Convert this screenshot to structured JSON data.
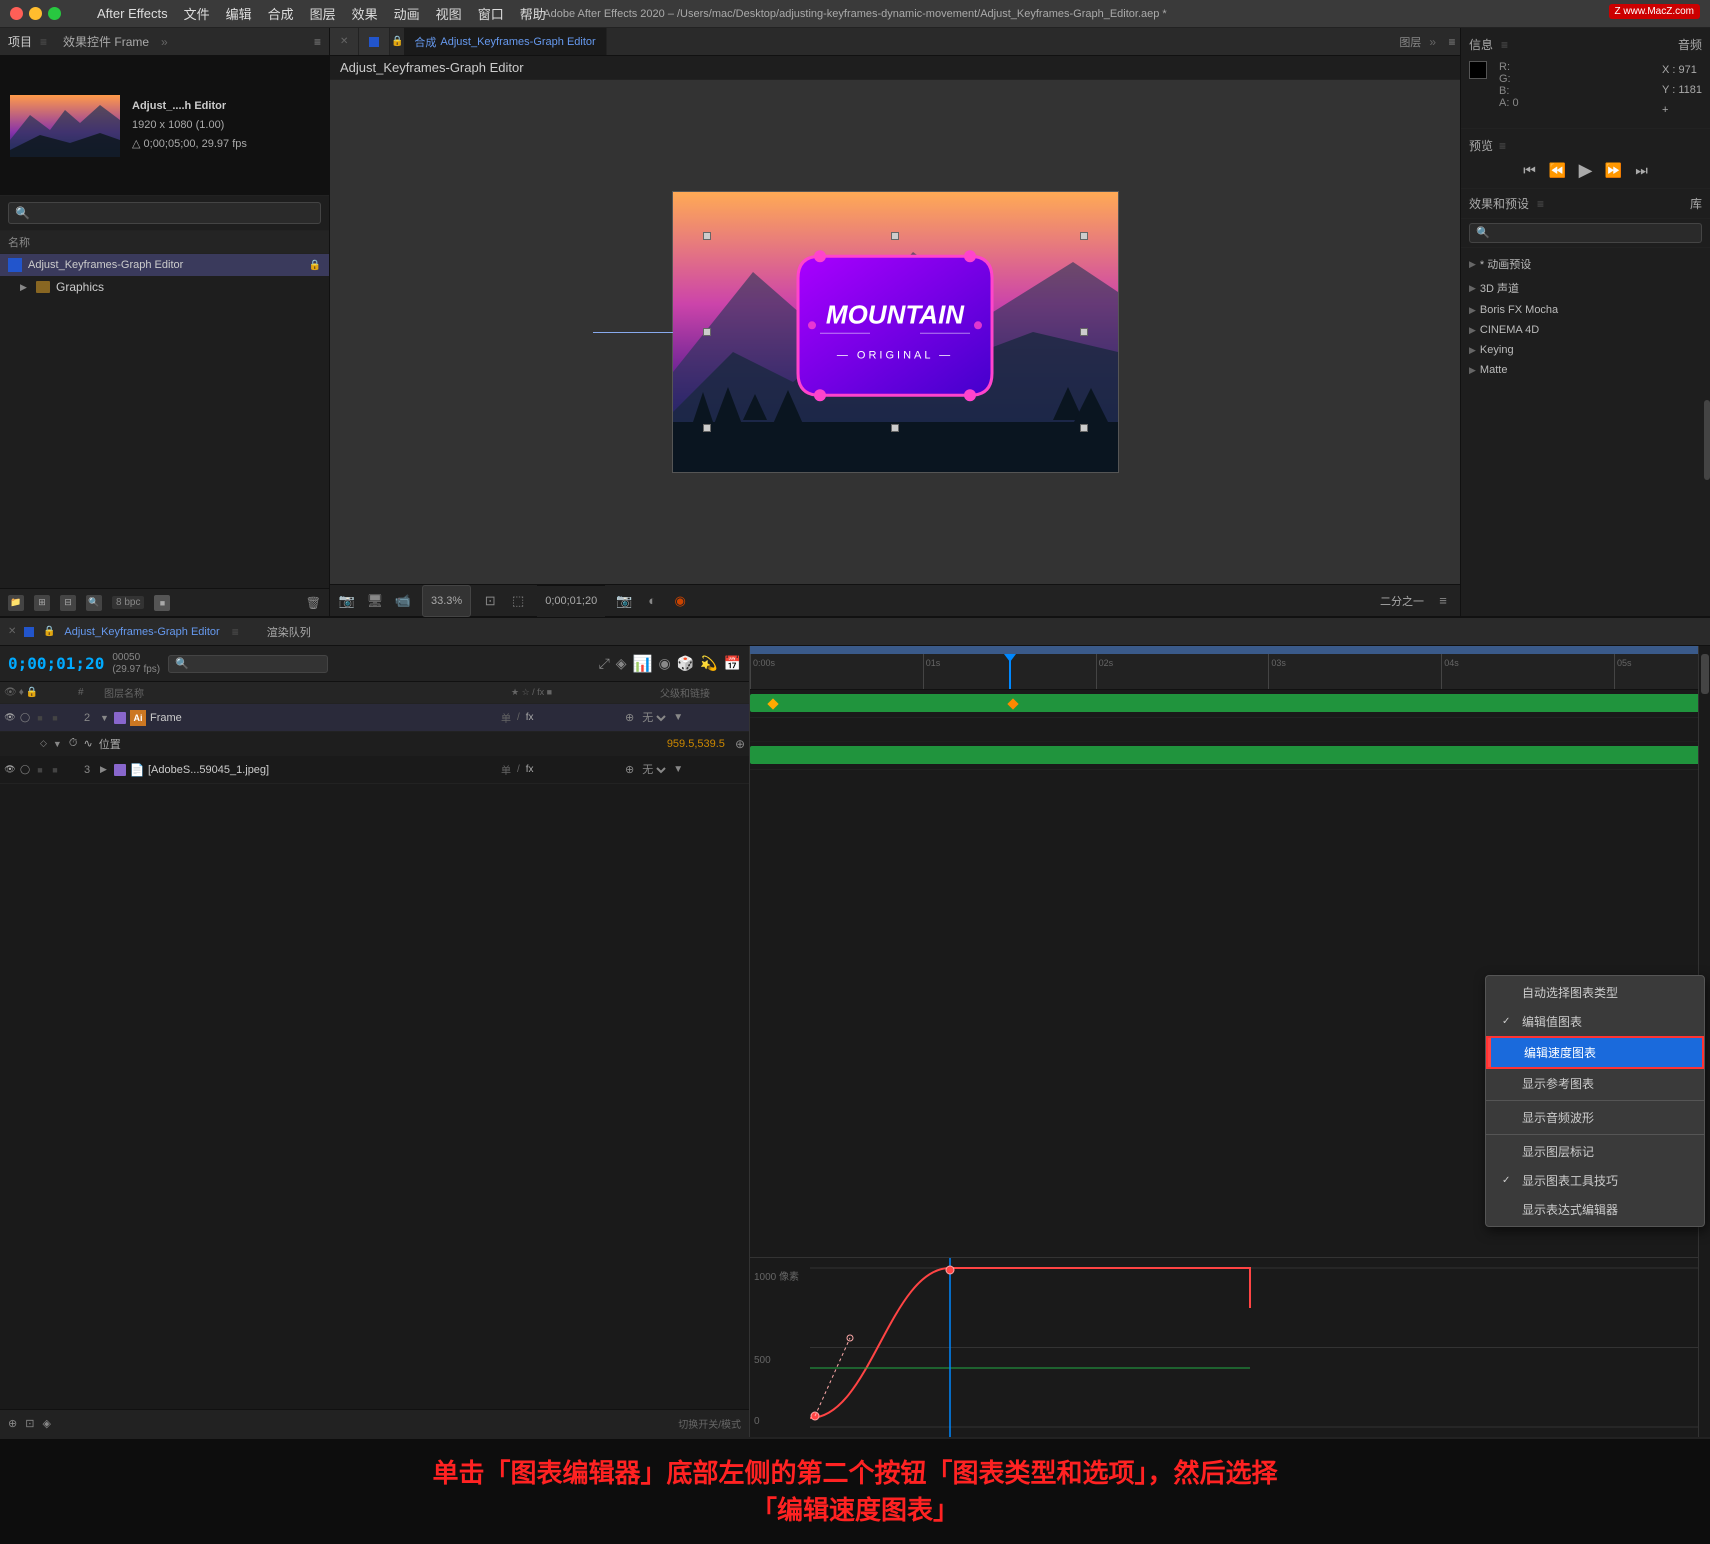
{
  "titleBar": {
    "appName": "After Effects",
    "filePath": "Adobe After Effects 2020 – /Users/mac/Desktop/adjusting-keyframes-dynamic-movement/Adjust_Keyframes-Graph_Editor.aep *",
    "menus": [
      "",
      "After Effects",
      "文件",
      "编辑",
      "合成",
      "图层",
      "效果",
      "动画",
      "视图",
      "窗口",
      "帮助"
    ],
    "watermark": "Z www.MacZ.com"
  },
  "leftPanel": {
    "tabs": [
      "项目",
      "效果控件 Frame"
    ],
    "thumbnail": {
      "name": "Adjust_....h Editor",
      "size": "1920 x 1080 (1.00)",
      "duration": "△ 0;00;05;00, 29.97 fps"
    },
    "searchPlaceholder": "🔍",
    "listHeader": "名称",
    "items": [
      {
        "type": "comp",
        "name": "Adjust_Keyframes-Graph Editor",
        "hasLock": true
      },
      {
        "type": "folder",
        "name": "Graphics",
        "hasLock": false
      }
    ],
    "bpc": "8 bpc"
  },
  "compPanel": {
    "tabs": [
      "合成 Adjust_Keyframes-Graph Editor"
    ],
    "title": "Adjust_Keyframes-Graph Editor",
    "otherTabs": [
      "图层"
    ],
    "zoom": "33.3%",
    "timecode": "0;00;01;20",
    "quality": "二分之一"
  },
  "rightPanel": {
    "infoHeader": "信息",
    "audioHeader": "音频",
    "rgbaLabels": [
      "R:",
      "G:",
      "B:",
      "A: 0"
    ],
    "xCoord": "X : 971",
    "yCoord": "Y : 1181",
    "previewHeader": "预览",
    "effectsHeader": "效果和预设",
    "libraryLabel": "库",
    "effectsItems": [
      "* 动画预设",
      "3D 声道",
      "Boris FX Mocha",
      "CINEMA 4D",
      "Keying",
      "Matte"
    ]
  },
  "timeline": {
    "tabLabel": "Adjust_Keyframes-Graph Editor",
    "renderQueue": "渲染队列",
    "timecode": "0;00;01;20",
    "fps": "00050 (29.97 fps)",
    "layersHeader": {
      "icons": [
        "👁",
        "♦",
        "🔒",
        "#",
        "图层名称",
        "★ ☆ / fx ■ ◯ △",
        "父级和链接"
      ]
    },
    "layers": [
      {
        "num": "2",
        "colorTag": "#8866cc",
        "typeIcon": "Ai",
        "name": "Frame",
        "switches": "单 / fx",
        "parentValue": "⊕ 无",
        "hasSubProp": true,
        "subProp": {
          "name": "位置",
          "value": "959.5,539.5",
          "hasKeyframes": true
        }
      },
      {
        "num": "3",
        "colorTag": "#8866cc",
        "typeIcon": "📄",
        "name": "[AdobeS...59045_1.jpeg]",
        "switches": "单 / fx",
        "parentValue": "⊕ 无",
        "hasSubProp": false
      }
    ],
    "rulerTicks": [
      "0:00s",
      "01s",
      "02s",
      "03s",
      "04s",
      "05s"
    ],
    "playheadPos": "28%",
    "graphArea": {
      "yLabels": [
        "1000 像素",
        "500"
      ],
      "curveColor": "#ff4444"
    }
  },
  "contextMenu": {
    "items": [
      {
        "label": "自动选择图表类型",
        "checked": false,
        "active": false
      },
      {
        "label": "编辑值图表",
        "checked": true,
        "active": false
      },
      {
        "label": "编辑速度图表",
        "checked": false,
        "active": true
      },
      {
        "label": "显示参考图表",
        "checked": false,
        "active": false
      },
      {
        "separator": true
      },
      {
        "label": "显示音频波形",
        "checked": false,
        "active": false
      },
      {
        "separator": true
      },
      {
        "label": "显示图层标记",
        "checked": false,
        "active": false
      },
      {
        "label": "显示图表工具技巧",
        "checked": true,
        "active": false
      },
      {
        "label": "显示表达式编辑器",
        "checked": false,
        "active": false
      }
    ]
  },
  "annotation": {
    "line1": "单击「图表编辑器」底部左侧的第二个按钮「图表类型和选项」，然后选择",
    "line2": "「编辑速度图表」"
  }
}
